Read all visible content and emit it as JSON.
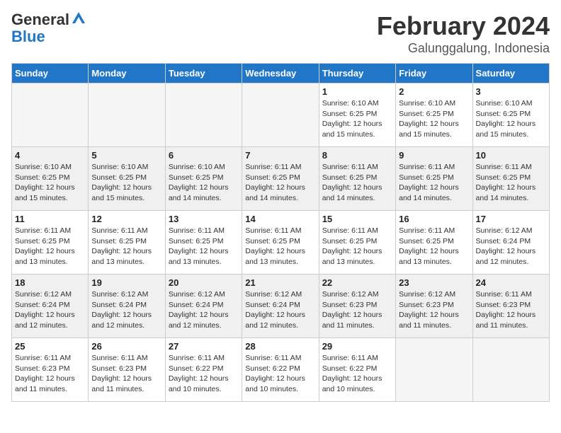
{
  "header": {
    "logo_line1": "General",
    "logo_line2": "Blue",
    "month": "February 2024",
    "location": "Galunggalung, Indonesia"
  },
  "weekdays": [
    "Sunday",
    "Monday",
    "Tuesday",
    "Wednesday",
    "Thursday",
    "Friday",
    "Saturday"
  ],
  "weeks": [
    [
      {
        "day": "",
        "info": ""
      },
      {
        "day": "",
        "info": ""
      },
      {
        "day": "",
        "info": ""
      },
      {
        "day": "",
        "info": ""
      },
      {
        "day": "1",
        "info": "Sunrise: 6:10 AM\nSunset: 6:25 PM\nDaylight: 12 hours\nand 15 minutes."
      },
      {
        "day": "2",
        "info": "Sunrise: 6:10 AM\nSunset: 6:25 PM\nDaylight: 12 hours\nand 15 minutes."
      },
      {
        "day": "3",
        "info": "Sunrise: 6:10 AM\nSunset: 6:25 PM\nDaylight: 12 hours\nand 15 minutes."
      }
    ],
    [
      {
        "day": "4",
        "info": "Sunrise: 6:10 AM\nSunset: 6:25 PM\nDaylight: 12 hours\nand 15 minutes."
      },
      {
        "day": "5",
        "info": "Sunrise: 6:10 AM\nSunset: 6:25 PM\nDaylight: 12 hours\nand 15 minutes."
      },
      {
        "day": "6",
        "info": "Sunrise: 6:10 AM\nSunset: 6:25 PM\nDaylight: 12 hours\nand 14 minutes."
      },
      {
        "day": "7",
        "info": "Sunrise: 6:11 AM\nSunset: 6:25 PM\nDaylight: 12 hours\nand 14 minutes."
      },
      {
        "day": "8",
        "info": "Sunrise: 6:11 AM\nSunset: 6:25 PM\nDaylight: 12 hours\nand 14 minutes."
      },
      {
        "day": "9",
        "info": "Sunrise: 6:11 AM\nSunset: 6:25 PM\nDaylight: 12 hours\nand 14 minutes."
      },
      {
        "day": "10",
        "info": "Sunrise: 6:11 AM\nSunset: 6:25 PM\nDaylight: 12 hours\nand 14 minutes."
      }
    ],
    [
      {
        "day": "11",
        "info": "Sunrise: 6:11 AM\nSunset: 6:25 PM\nDaylight: 12 hours\nand 13 minutes."
      },
      {
        "day": "12",
        "info": "Sunrise: 6:11 AM\nSunset: 6:25 PM\nDaylight: 12 hours\nand 13 minutes."
      },
      {
        "day": "13",
        "info": "Sunrise: 6:11 AM\nSunset: 6:25 PM\nDaylight: 12 hours\nand 13 minutes."
      },
      {
        "day": "14",
        "info": "Sunrise: 6:11 AM\nSunset: 6:25 PM\nDaylight: 12 hours\nand 13 minutes."
      },
      {
        "day": "15",
        "info": "Sunrise: 6:11 AM\nSunset: 6:25 PM\nDaylight: 12 hours\nand 13 minutes."
      },
      {
        "day": "16",
        "info": "Sunrise: 6:11 AM\nSunset: 6:25 PM\nDaylight: 12 hours\nand 13 minutes."
      },
      {
        "day": "17",
        "info": "Sunrise: 6:12 AM\nSunset: 6:24 PM\nDaylight: 12 hours\nand 12 minutes."
      }
    ],
    [
      {
        "day": "18",
        "info": "Sunrise: 6:12 AM\nSunset: 6:24 PM\nDaylight: 12 hours\nand 12 minutes."
      },
      {
        "day": "19",
        "info": "Sunrise: 6:12 AM\nSunset: 6:24 PM\nDaylight: 12 hours\nand 12 minutes."
      },
      {
        "day": "20",
        "info": "Sunrise: 6:12 AM\nSunset: 6:24 PM\nDaylight: 12 hours\nand 12 minutes."
      },
      {
        "day": "21",
        "info": "Sunrise: 6:12 AM\nSunset: 6:24 PM\nDaylight: 12 hours\nand 12 minutes."
      },
      {
        "day": "22",
        "info": "Sunrise: 6:12 AM\nSunset: 6:23 PM\nDaylight: 12 hours\nand 11 minutes."
      },
      {
        "day": "23",
        "info": "Sunrise: 6:12 AM\nSunset: 6:23 PM\nDaylight: 12 hours\nand 11 minutes."
      },
      {
        "day": "24",
        "info": "Sunrise: 6:11 AM\nSunset: 6:23 PM\nDaylight: 12 hours\nand 11 minutes."
      }
    ],
    [
      {
        "day": "25",
        "info": "Sunrise: 6:11 AM\nSunset: 6:23 PM\nDaylight: 12 hours\nand 11 minutes."
      },
      {
        "day": "26",
        "info": "Sunrise: 6:11 AM\nSunset: 6:23 PM\nDaylight: 12 hours\nand 11 minutes."
      },
      {
        "day": "27",
        "info": "Sunrise: 6:11 AM\nSunset: 6:22 PM\nDaylight: 12 hours\nand 10 minutes."
      },
      {
        "day": "28",
        "info": "Sunrise: 6:11 AM\nSunset: 6:22 PM\nDaylight: 12 hours\nand 10 minutes."
      },
      {
        "day": "29",
        "info": "Sunrise: 6:11 AM\nSunset: 6:22 PM\nDaylight: 12 hours\nand 10 minutes."
      },
      {
        "day": "",
        "info": ""
      },
      {
        "day": "",
        "info": ""
      }
    ]
  ]
}
